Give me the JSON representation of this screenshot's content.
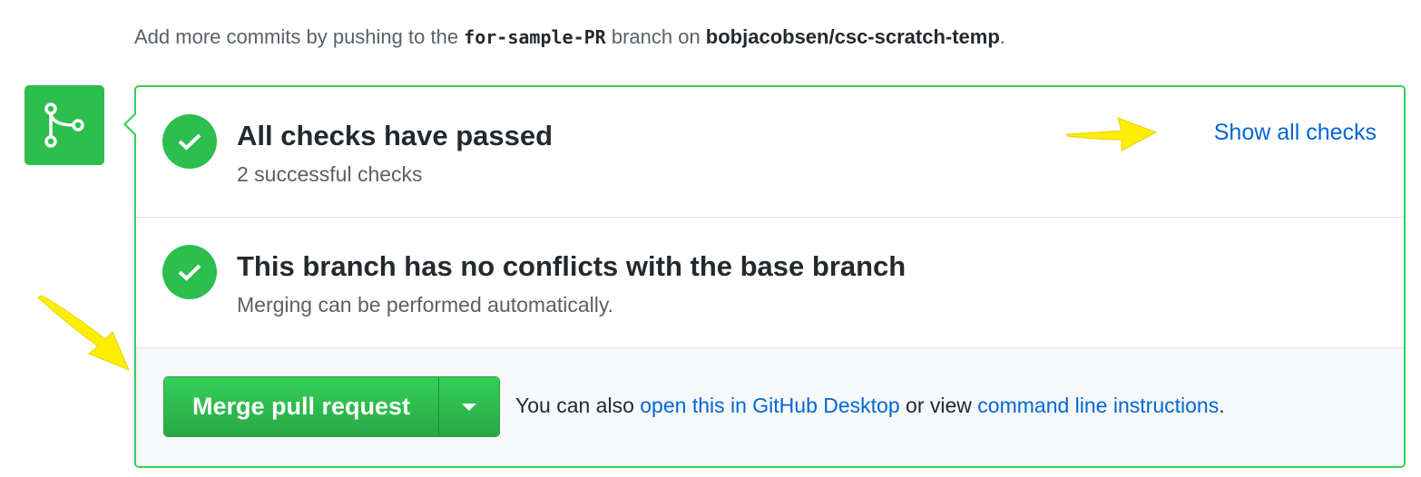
{
  "hint": {
    "prefix": "Add more commits by pushing to the ",
    "branch": "for-sample-PR",
    "middle": " branch on ",
    "repo": "bobjacobsen/csc-scratch-temp",
    "suffix": "."
  },
  "checks": {
    "title": "All checks have passed",
    "subtitle": "2 successful checks",
    "show_all_link": "Show all checks"
  },
  "conflicts": {
    "title": "This branch has no conflicts with the base branch",
    "subtitle": "Merging can be performed automatically."
  },
  "merge": {
    "button_label": "Merge pull request",
    "also_prefix": "You can also ",
    "desktop_link": "open this in GitHub Desktop",
    "also_middle": " or view ",
    "cli_link": "command line instructions",
    "also_suffix": "."
  },
  "icons": {
    "badge": "git-merge-icon",
    "check": "check-icon",
    "caret": "caret-down-icon",
    "annotation": "yellow-arrow-icon"
  },
  "colors": {
    "success": "#2cbe4e",
    "border": "#34d058",
    "link": "#0366d6",
    "annotation": "#ffee00"
  }
}
